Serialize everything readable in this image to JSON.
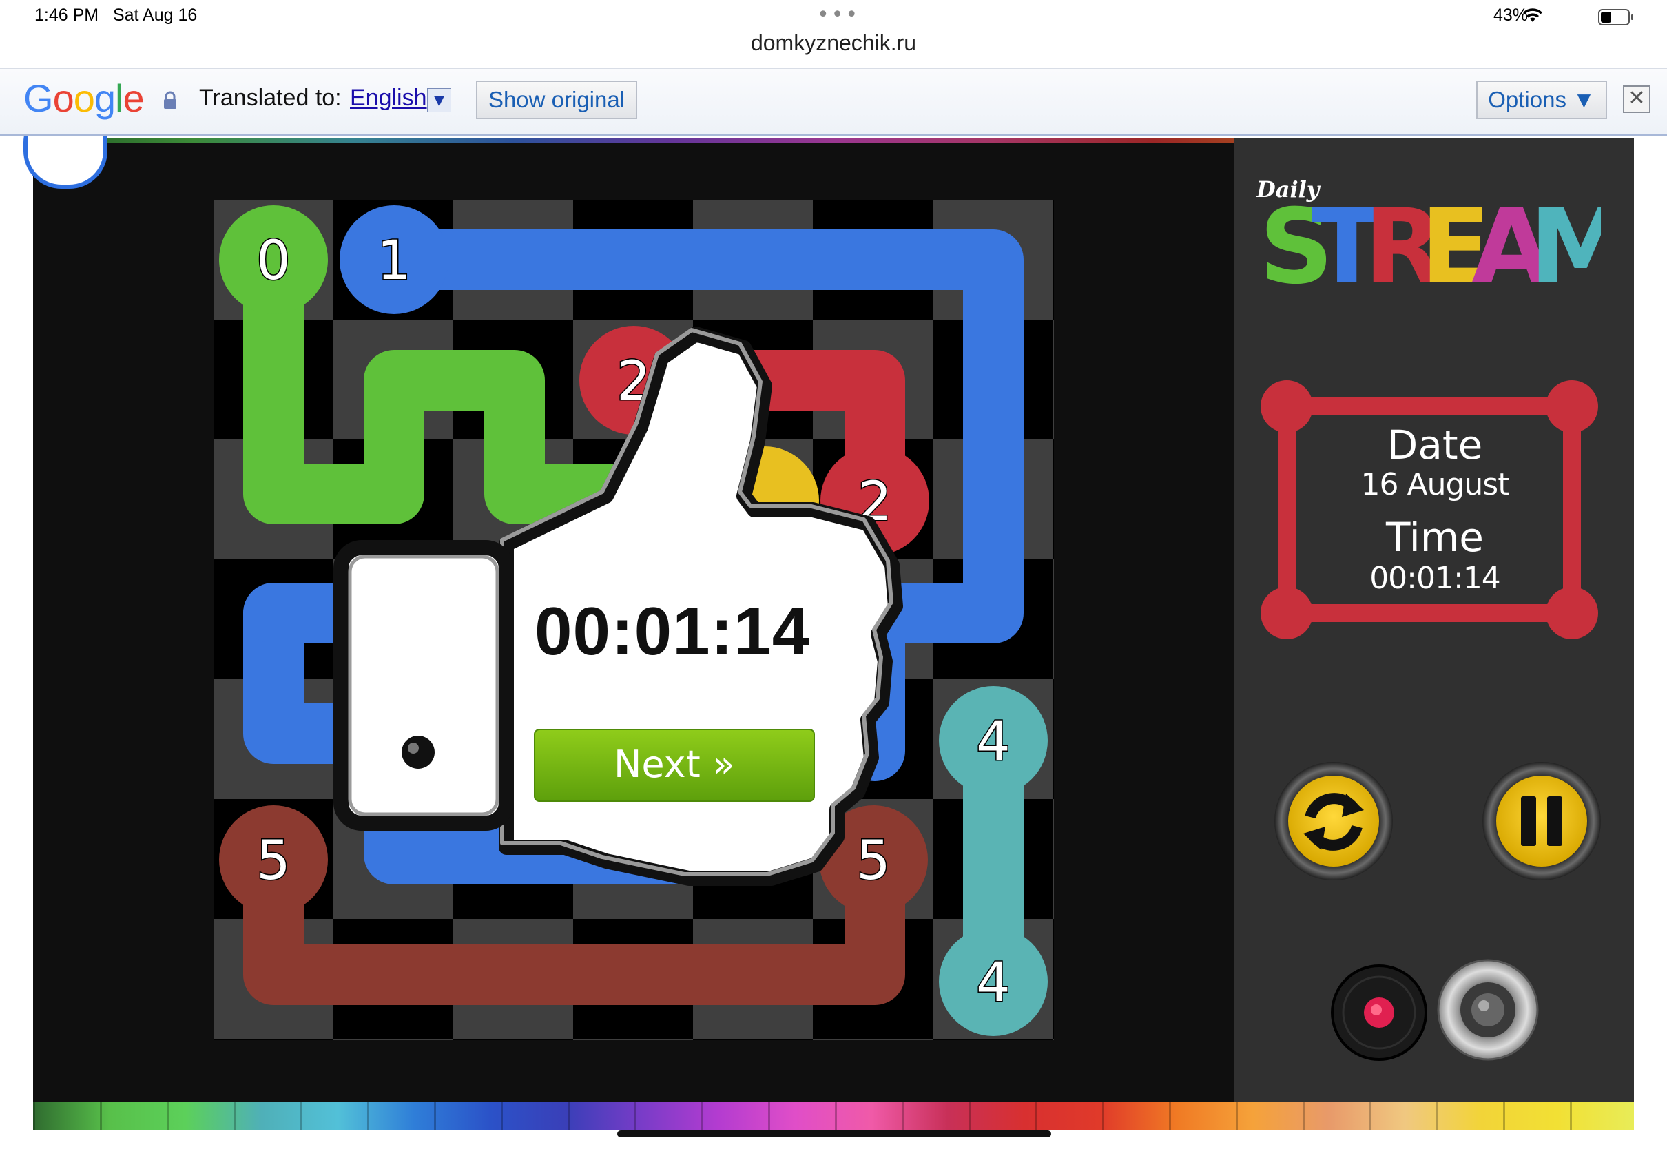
{
  "status_bar": {
    "time": "1:46 PM",
    "date": "Sat Aug 16",
    "battery_percent": "43%",
    "url": "domkyznechik.ru"
  },
  "translate_bar": {
    "logo": "Google",
    "translated_to_label": "Translated to:",
    "language": "English",
    "show_original_label": "Show original",
    "options_label": "Options ▼",
    "close_label": "✕"
  },
  "game": {
    "brand_small": "Daily",
    "brand_large": "STREAM",
    "date_label": "Date",
    "date_value": "16 August",
    "time_label": "Time",
    "time_value": "00:01:14",
    "result_time": "00:01:14",
    "next_label": "Next »",
    "endpoints": [
      {
        "label": "0",
        "color": "#5fc13a"
      },
      {
        "label": "1",
        "color": "#3a77e0"
      },
      {
        "label": "2",
        "color": "#c8303c"
      },
      {
        "label": "2",
        "color": "#c8303c"
      },
      {
        "label": "4",
        "color": "#5ab4b4"
      },
      {
        "label": "4",
        "color": "#5ab4b4"
      },
      {
        "label": "5",
        "color": "#8c3a30"
      },
      {
        "label": "5",
        "color": "#8c3a30"
      }
    ],
    "colors": {
      "green": "#5fc13a",
      "blue": "#3a77e0",
      "red": "#c8303c",
      "yellow": "#e8c020",
      "teal": "#5ab4b4",
      "brown": "#8c3a30",
      "panel": "#303030",
      "button_yellow": "#f2c21a"
    },
    "controls": [
      "restart-icon",
      "pause-icon",
      "record-icon",
      "speaker-icon"
    ]
  }
}
